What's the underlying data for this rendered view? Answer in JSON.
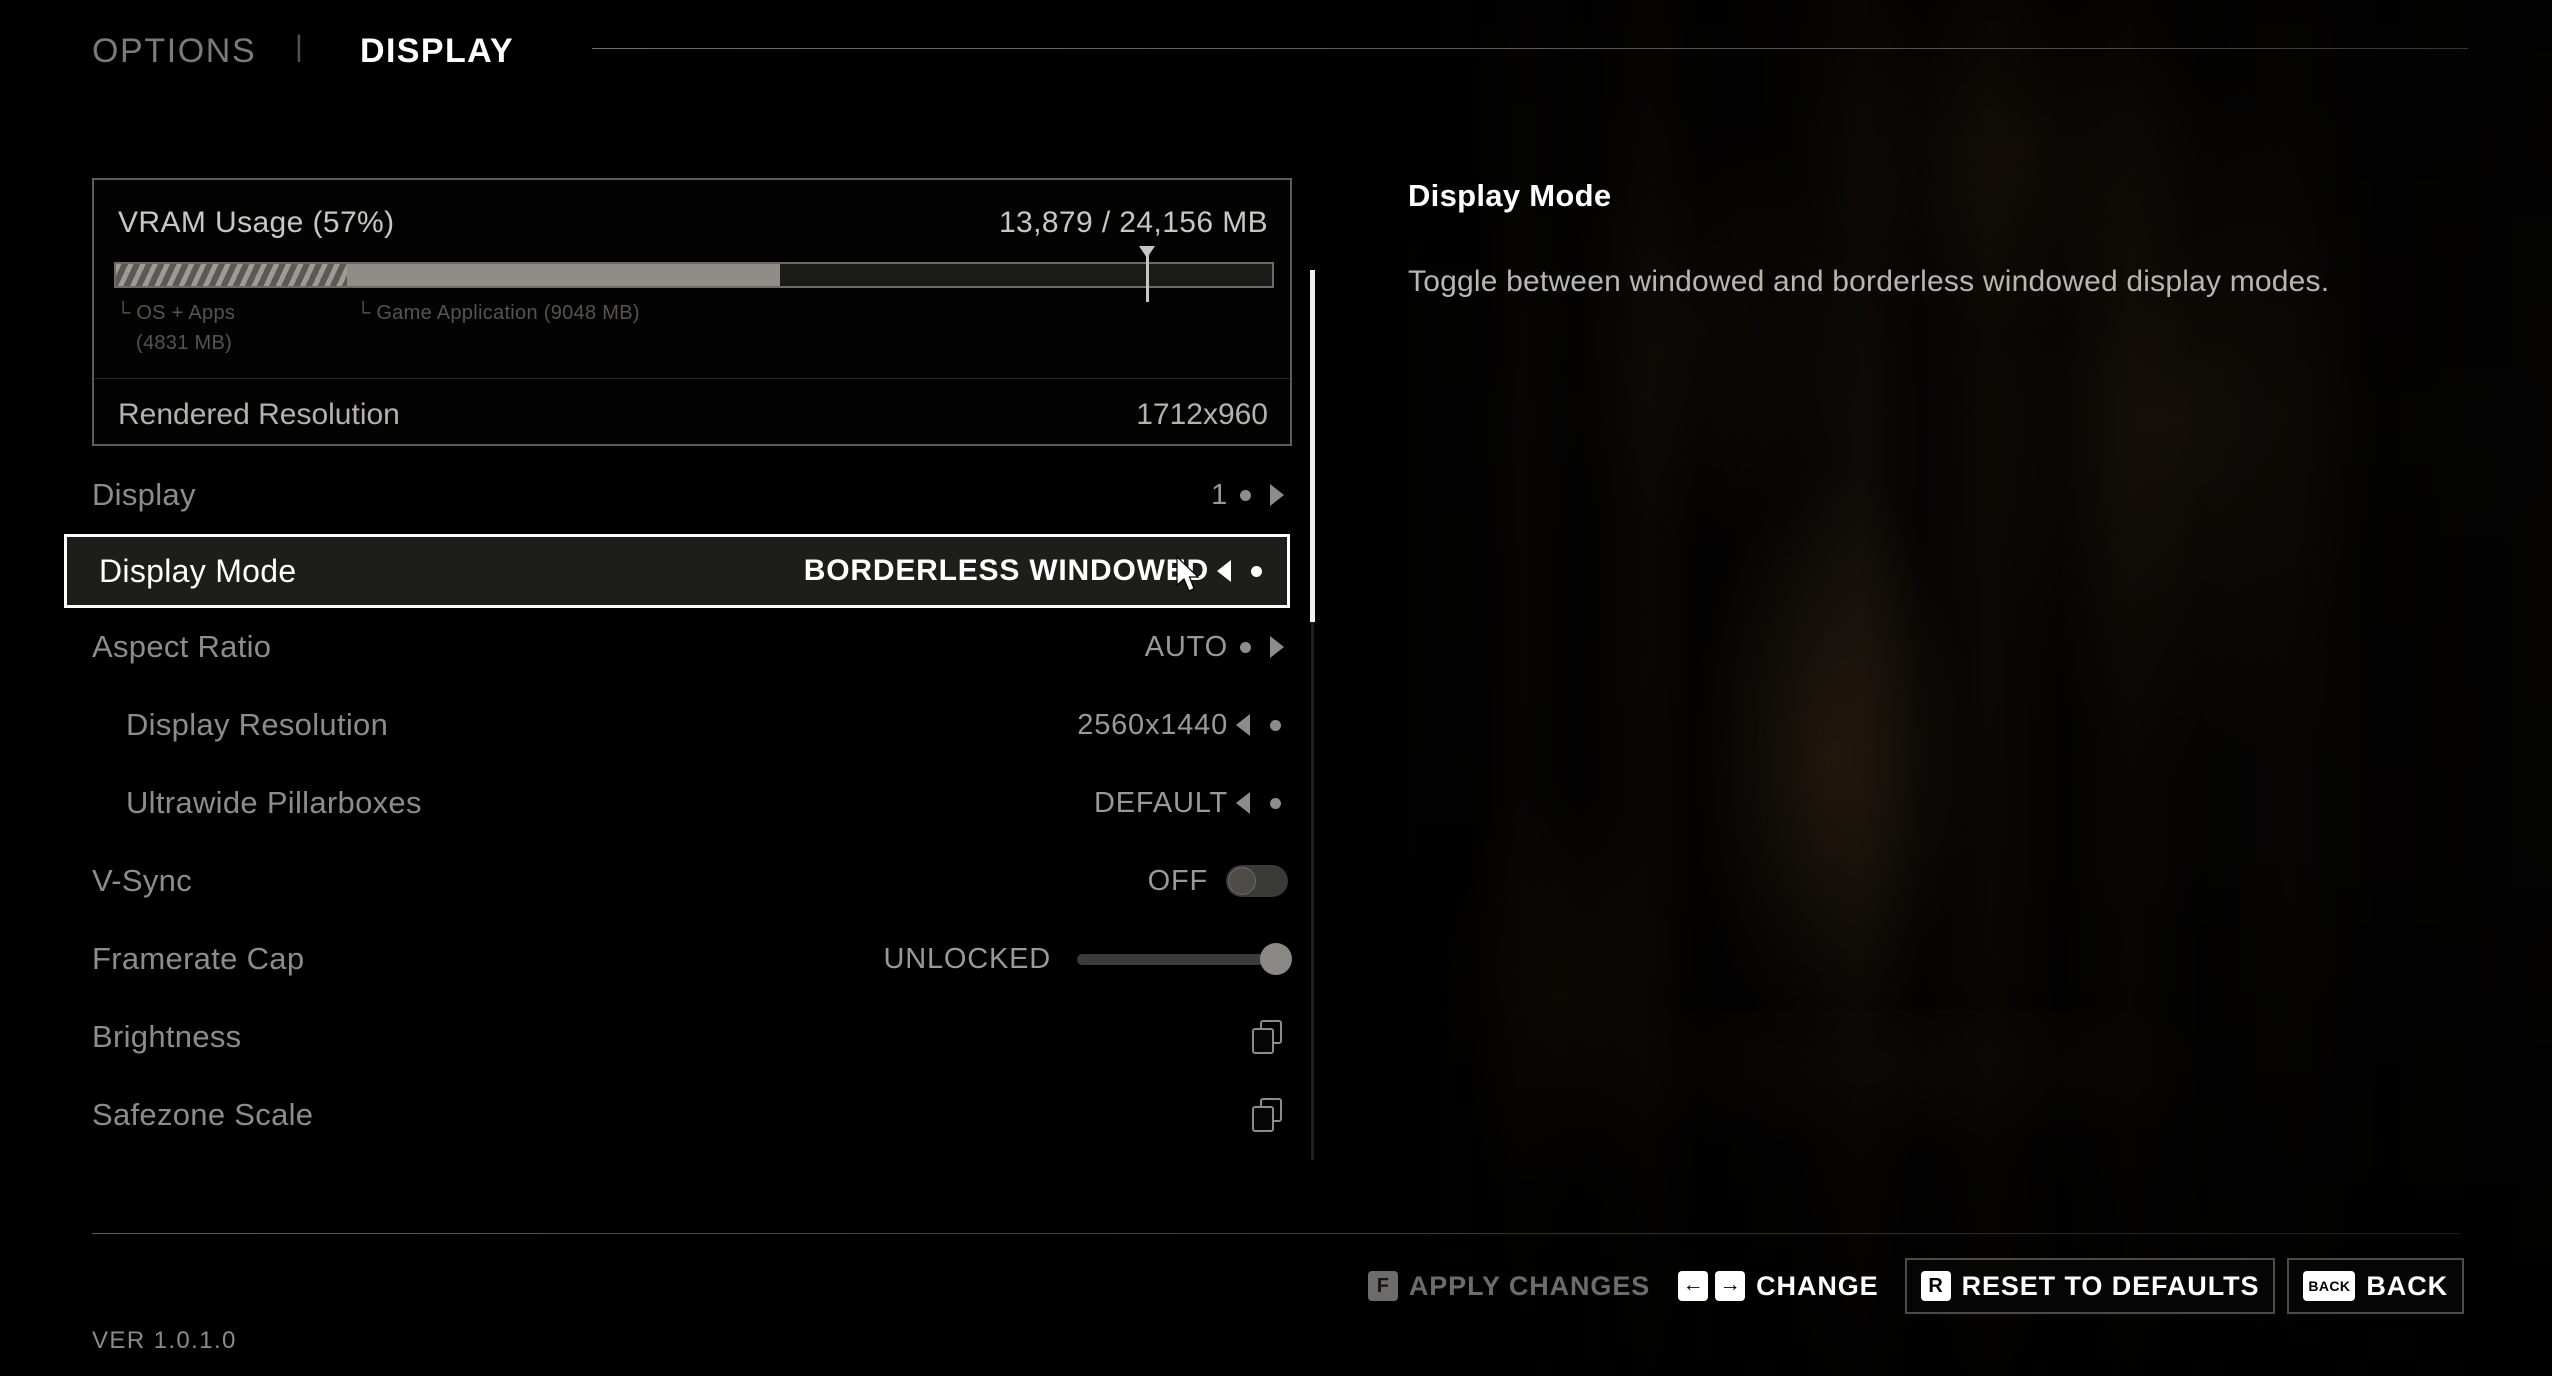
{
  "header": {
    "breadcrumb_parent": "OPTIONS",
    "breadcrumb_separator": "|",
    "breadcrumb_current": "DISPLAY"
  },
  "vram_panel": {
    "title": "VRAM Usage (57%)",
    "amount": "13,879 / 24,156 MB",
    "percent_used": 57,
    "os_label": "└ OS + Apps",
    "os_label_2": "(4831 MB)",
    "os_mb": 4831,
    "game_label": "└ Game Application (9048 MB)",
    "game_mb": 9048,
    "total_mb": 24156,
    "used_mb": 13879,
    "marker_percent": 89,
    "rendered_resolution_label": "Rendered Resolution",
    "rendered_resolution_value": "1712x960"
  },
  "settings_rows": [
    {
      "name": "display",
      "label": "Display",
      "value": "1",
      "control": "selector",
      "arrow": "right",
      "indent": false,
      "selected": false
    },
    {
      "name": "display-mode",
      "label": "Display Mode",
      "value": "BORDERLESS WINDOWED",
      "control": "selector",
      "arrow": "left",
      "indent": false,
      "selected": true
    },
    {
      "name": "aspect-ratio",
      "label": "Aspect Ratio",
      "value": "AUTO",
      "control": "selector",
      "arrow": "right",
      "indent": false,
      "selected": false
    },
    {
      "name": "display-resolution",
      "label": "Display Resolution",
      "value": "2560x1440",
      "control": "selector",
      "arrow": "left",
      "indent": true,
      "selected": false
    },
    {
      "name": "ultrawide-pillarboxes",
      "label": "Ultrawide Pillarboxes",
      "value": "DEFAULT",
      "control": "selector",
      "arrow": "left",
      "indent": true,
      "selected": false
    },
    {
      "name": "v-sync",
      "label": "V-Sync",
      "value": "OFF",
      "control": "toggle",
      "toggle_on": false,
      "indent": false,
      "selected": false
    },
    {
      "name": "framerate-cap",
      "label": "Framerate Cap",
      "value": "UNLOCKED",
      "control": "slider",
      "slider_percent": 100,
      "indent": false,
      "selected": false
    },
    {
      "name": "brightness",
      "label": "Brightness",
      "value": "",
      "control": "submenu",
      "indent": false,
      "selected": false
    },
    {
      "name": "safezone-scale",
      "label": "Safezone Scale",
      "value": "",
      "control": "submenu",
      "indent": false,
      "selected": false
    }
  ],
  "description": {
    "title": "Display Mode",
    "body": "Toggle between windowed and borderless windowed display modes."
  },
  "footer": {
    "version": "VER 1.0.1.0",
    "actions": [
      {
        "name": "apply-changes",
        "keys": [
          "F"
        ],
        "label": "APPLY CHANGES",
        "disabled": true,
        "boxed": false
      },
      {
        "name": "change",
        "keys": [
          "←",
          "→"
        ],
        "label": "CHANGE",
        "disabled": false,
        "boxed": false
      },
      {
        "name": "reset-to-defaults",
        "keys": [
          "R"
        ],
        "label": "RESET TO DEFAULTS",
        "disabled": false,
        "boxed": true
      },
      {
        "name": "back",
        "keys": [
          "BACK"
        ],
        "label": "BACK",
        "disabled": false,
        "boxed": true
      }
    ]
  },
  "colors": {
    "highlight": "#ffffff",
    "panel_border": "#5e5c58",
    "text_dim": "#8e8c88",
    "background": "#000000"
  }
}
